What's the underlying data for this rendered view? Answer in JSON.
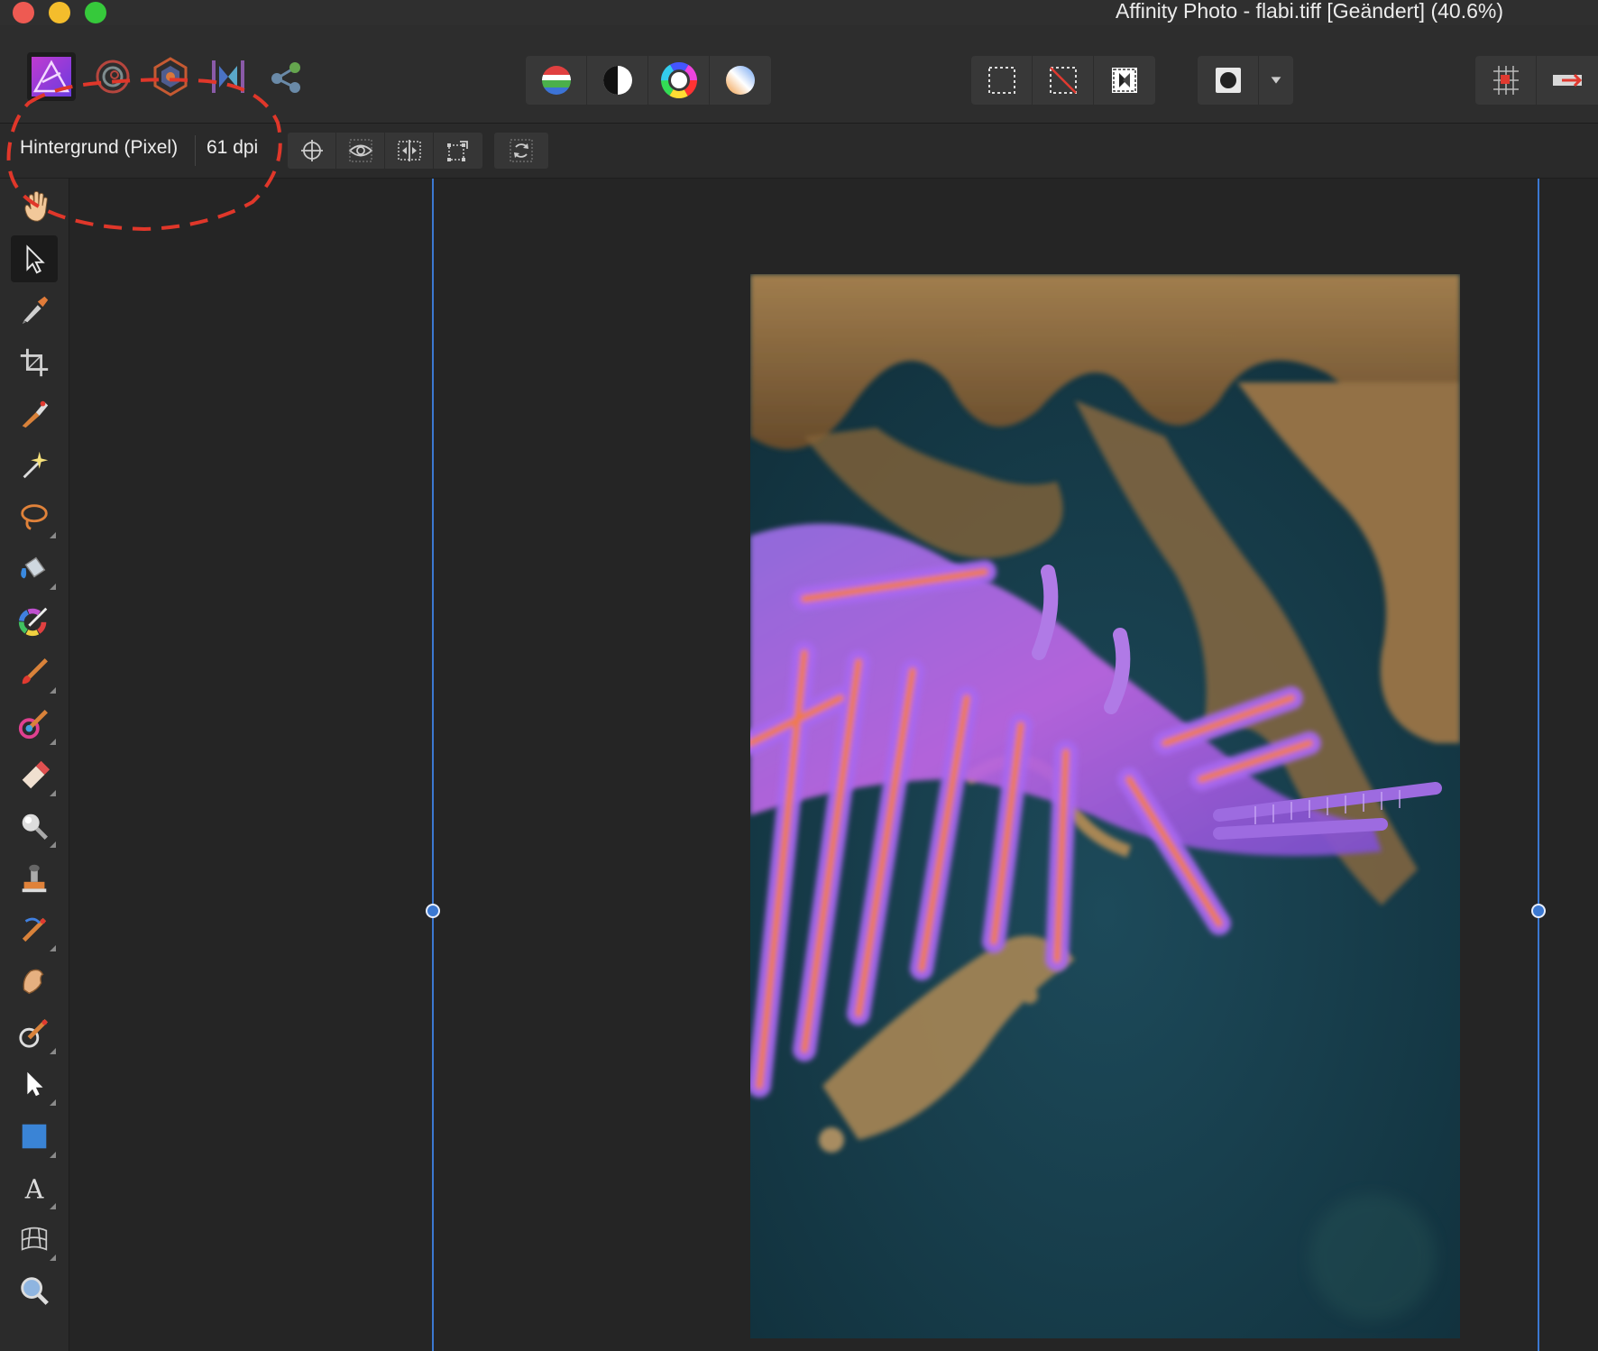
{
  "window": {
    "title": "Affinity Photo - flabi.tiff [Geändert] (40.6%)",
    "controls": [
      "close",
      "minimize",
      "maximize"
    ]
  },
  "toolbar": {
    "personas": [
      {
        "name": "photo-persona-icon"
      },
      {
        "name": "liquify-persona-icon"
      },
      {
        "name": "develop-persona-icon"
      },
      {
        "name": "tone-mapping-persona-icon"
      },
      {
        "name": "export-persona-icon"
      }
    ],
    "adjust_group": [
      "levels-icon",
      "auto-contrast-icon",
      "color-wheel-icon",
      "white-balance-icon"
    ],
    "selection_group": [
      "select-all-icon",
      "deselect-icon",
      "invert-selection-icon"
    ],
    "mask_group": [
      "quick-mask-icon",
      "dropdown-arrow-icon"
    ],
    "right_group": [
      "snapping-icon",
      "assistant-icon"
    ]
  },
  "context": {
    "layer_label": "Hintergrund (Pixel)",
    "dpi": "61 dpi",
    "buttons": [
      "target-icon",
      "view-icon",
      "flip-horizontal-icon",
      "transform-icon",
      "rotate-icon"
    ]
  },
  "tools": [
    "hand-tool-icon",
    "move-tool-icon",
    "color-picker-icon",
    "crop-tool-icon",
    "selection-brush-icon",
    "flood-select-icon",
    "freehand-selection-icon",
    "flood-fill-icon",
    "gradient-tool-icon",
    "paint-brush-icon",
    "color-replacement-icon",
    "erase-brush-icon",
    "dodge-tool-icon",
    "clone-brush-icon",
    "healing-brush-icon",
    "smudge-tool-icon",
    "red-eye-icon",
    "node-tool-icon",
    "rectangle-tool-icon",
    "text-tool-icon",
    "mesh-warp-icon",
    "zoom-tool-icon"
  ],
  "colors": {
    "accent": "#3b78d1",
    "annotation": "#e0372a",
    "background": "#262626"
  }
}
